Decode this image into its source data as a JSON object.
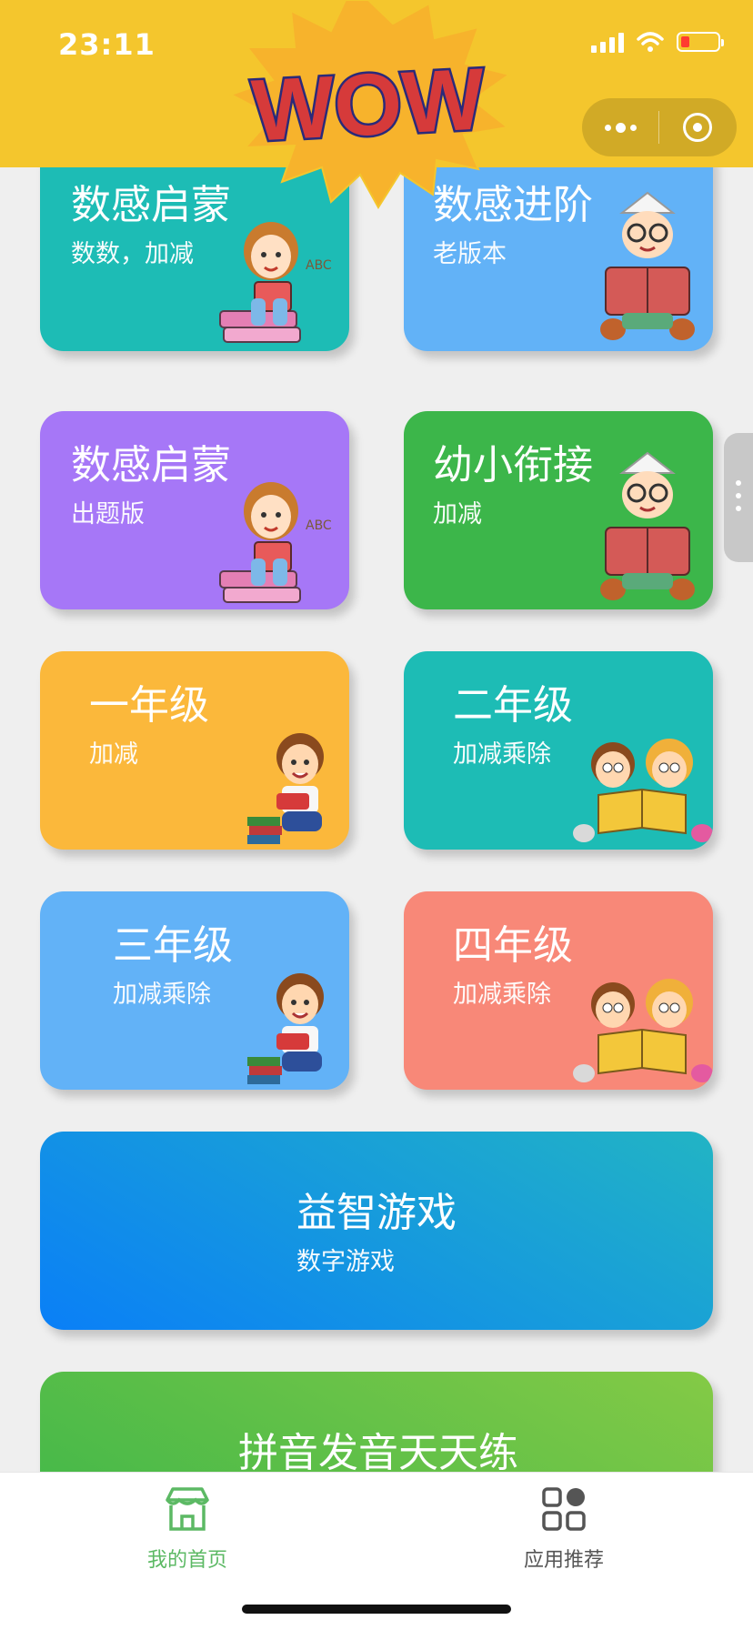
{
  "status_bar": {
    "time": "23:11"
  },
  "header": {
    "logo_text": "WOW"
  },
  "cards": [
    {
      "title": "数感启蒙",
      "subtitle": "数数，加减",
      "color": "#1dbcb5",
      "illustration": "girl-reading-book-icon"
    },
    {
      "title": "数感进阶",
      "subtitle": "老版本",
      "color": "#62b2f7",
      "illustration": "boy-reading-book-icon"
    },
    {
      "title": "数感启蒙",
      "subtitle": "出题版",
      "color": "#a677f7",
      "illustration": "girl-reading-book-icon"
    },
    {
      "title": "幼小衔接",
      "subtitle": "加减",
      "color": "#3cb64a",
      "illustration": "boy-reading-book-icon"
    },
    {
      "title": "一年级",
      "subtitle": "加减",
      "color": "#fbb83b",
      "illustration": "boy-with-books-icon"
    },
    {
      "title": "二年级",
      "subtitle": "加减乘除",
      "color": "#1dbcb5",
      "illustration": "two-kids-reading-icon"
    },
    {
      "title": "三年级",
      "subtitle": "加减乘除",
      "color": "#62b2f7",
      "illustration": "boy-with-books-icon"
    },
    {
      "title": "四年级",
      "subtitle": "加减乘除",
      "color": "#f88878",
      "illustration": "two-kids-reading-icon"
    }
  ],
  "wide_cards": [
    {
      "title": "益智游戏",
      "subtitle": "数字游戏",
      "color_from": "#1185f4",
      "color_to": "#22b4c4"
    },
    {
      "title": "拼音发音天天练",
      "subtitle": "",
      "color_from": "#45b54a",
      "color_to": "#82c94a"
    }
  ],
  "tabbar": {
    "items": [
      {
        "label": "我的首页",
        "icon": "home-icon",
        "active": true
      },
      {
        "label": "应用推荐",
        "icon": "apps-grid-icon",
        "active": false
      }
    ],
    "active_color": "#5cb964",
    "inactive_color": "#555555"
  }
}
